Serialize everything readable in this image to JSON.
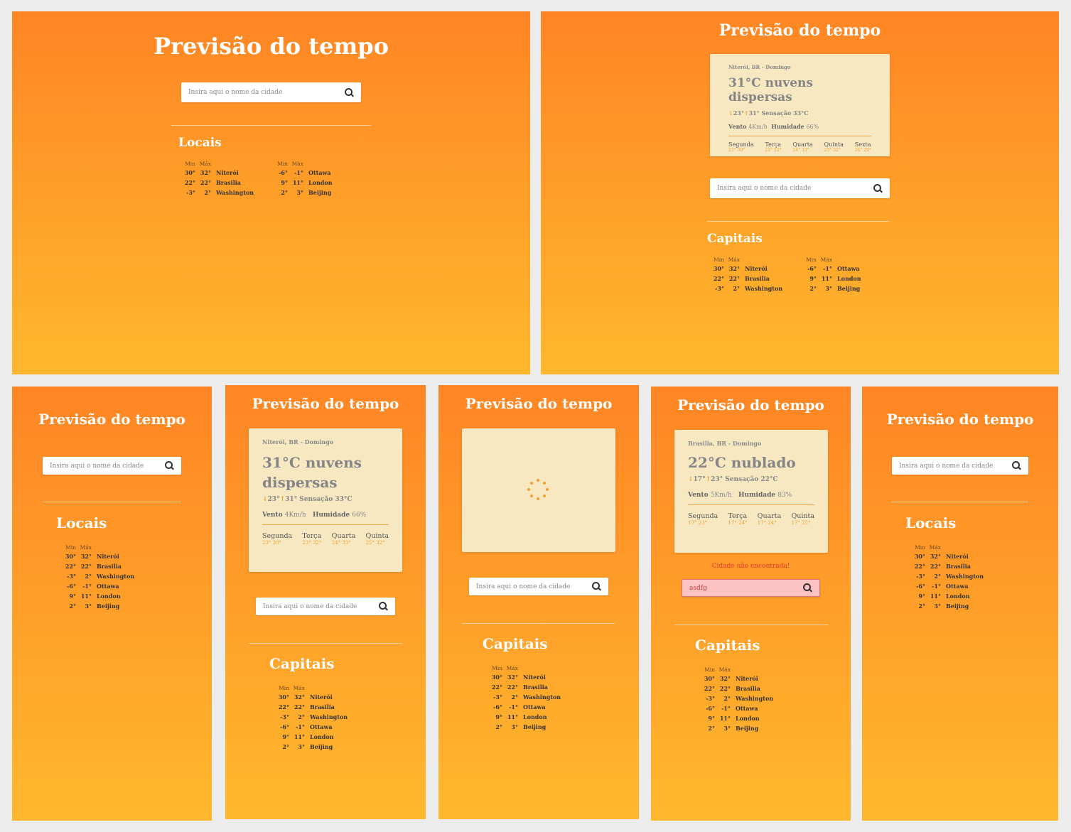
{
  "app": {
    "title": "Previsão do tempo",
    "search_placeholder": "Insira aqui o nome da cidade",
    "search_icon": "search-icon",
    "accent": "#ff8524",
    "accent_bottom": "#ffb82e"
  },
  "sections": {
    "locais": "Locais",
    "capitais": "Capitais"
  },
  "table_headers": {
    "min": "Min",
    "max": "Máx"
  },
  "cities": [
    {
      "min": "30°",
      "max": "32°",
      "name": "Niterói"
    },
    {
      "min": "22°",
      "max": "22°",
      "name": "Brasilia"
    },
    {
      "min": "-3°",
      "max": "2°",
      "name": "Washington"
    },
    {
      "min": "-6°",
      "max": "-1°",
      "name": "Ottawa"
    },
    {
      "min": "9°",
      "max": "11°",
      "name": "London"
    },
    {
      "min": "2°",
      "max": "3°",
      "name": "Beijing"
    }
  ],
  "niteroi": {
    "location": "Niterói, BR - Domingo",
    "temp_desc": "31°C nuvens dispersas",
    "min": "23°",
    "max": "31°",
    "feels": "Sensação 33°C",
    "wind_label": "Vento",
    "wind_value": "4Km/h",
    "humidity_label": "Humidade",
    "humidity_value": "66%",
    "days": [
      {
        "name": "Segunda",
        "temps": "23° 30°"
      },
      {
        "name": "Terça",
        "temps": "23° 32°"
      },
      {
        "name": "Quarta",
        "temps": "24° 33°"
      },
      {
        "name": "Quinta",
        "temps": "25° 32°"
      },
      {
        "name": "Sexta",
        "temps": "24° 29°"
      }
    ]
  },
  "brasilia": {
    "location": "Brasilia, BR - Domingo",
    "temp_desc": "22°C nublado",
    "min": "17°",
    "max": "23°",
    "feels": "Sensação 22°C",
    "wind_label": "Vento",
    "wind_value": "5Km/h",
    "humidity_label": "Humidade",
    "humidity_value": "83%",
    "days": [
      {
        "name": "Segunda",
        "temps": "17° 23°"
      },
      {
        "name": "Terça",
        "temps": "17° 24°"
      },
      {
        "name": "Quarta",
        "temps": "17° 24°"
      },
      {
        "name": "Quinta",
        "temps": "17° 25°"
      }
    ]
  },
  "error": {
    "message": "Cidade não encontrada!",
    "input_value": "asdfg"
  }
}
